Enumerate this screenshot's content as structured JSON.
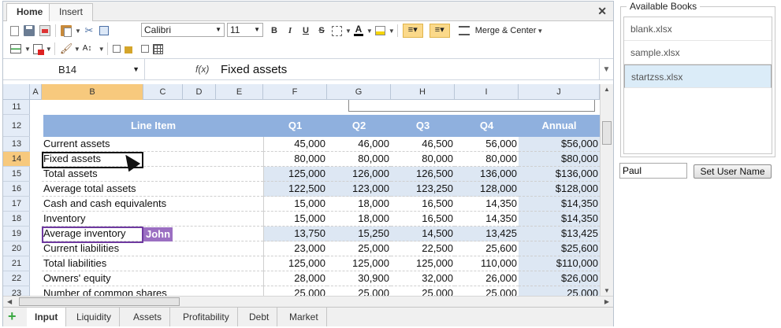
{
  "ribbon": {
    "tabs": [
      {
        "label": "Home",
        "active": true
      },
      {
        "label": "Insert",
        "active": false
      }
    ],
    "close_icon": "✕",
    "font_family": "Calibri",
    "font_size": "11",
    "bold": "B",
    "italic": "I",
    "underline": "U",
    "strike": "S",
    "font_color_glyph": "A",
    "merge_label": "Merge & Center"
  },
  "formula": {
    "cell_ref": "B14",
    "fx": "f(x)",
    "value": "Fixed assets"
  },
  "columns": [
    "A",
    "B",
    "C",
    "D",
    "E",
    "F",
    "G",
    "H",
    "I",
    "J"
  ],
  "active_column": "B",
  "rows": [
    "11",
    "12",
    "13",
    "14",
    "15",
    "16",
    "17",
    "18",
    "19",
    "20",
    "21",
    "22",
    "23"
  ],
  "active_row": "14",
  "table": {
    "headers": [
      "Line Item",
      "Q1",
      "Q2",
      "Q3",
      "Q4",
      "Annual"
    ],
    "data": [
      [
        "Current assets",
        "45,000",
        "46,000",
        "46,500",
        "56,000",
        "$56,000"
      ],
      [
        "Fixed assets",
        "80,000",
        "80,000",
        "80,000",
        "80,000",
        "$80,000"
      ],
      [
        "Total assets",
        "125,000",
        "126,000",
        "126,500",
        "136,000",
        "$136,000"
      ],
      [
        "Average total assets",
        "122,500",
        "123,000",
        "123,250",
        "128,000",
        "$128,000"
      ],
      [
        "Cash and cash equivalents",
        "15,000",
        "18,000",
        "16,500",
        "14,350",
        "$14,350"
      ],
      [
        "Inventory",
        "15,000",
        "18,000",
        "16,500",
        "14,350",
        "$14,350"
      ],
      [
        "Average inventory",
        "13,750",
        "15,250",
        "14,500",
        "13,425",
        "$13,425"
      ],
      [
        "Current liabilities",
        "23,000",
        "25,000",
        "22,500",
        "25,600",
        "$25,600"
      ],
      [
        "Total liabilities",
        "125,000",
        "125,000",
        "125,000",
        "110,000",
        "$110,000"
      ],
      [
        "Owners' equity",
        "28,000",
        "30,900",
        "32,000",
        "26,000",
        "$26,000"
      ],
      [
        "Number of common shares",
        "25,000",
        "25,000",
        "25,000",
        "25,000",
        "25,000"
      ]
    ],
    "shaded_rows": [
      2,
      3,
      6
    ]
  },
  "collaborator": {
    "name": "John",
    "color": "#9b6fc2",
    "row_index": 6
  },
  "sheet_tabs": [
    {
      "label": "Input",
      "active": true
    },
    {
      "label": "Liquidity",
      "active": false
    },
    {
      "label": "Assets",
      "active": false
    },
    {
      "label": "Profitability",
      "active": false
    },
    {
      "label": "Debt",
      "active": false
    },
    {
      "label": "Market",
      "active": false
    }
  ],
  "panel": {
    "legend": "Available Books",
    "books": [
      {
        "label": "blank.xlsx",
        "selected": false
      },
      {
        "label": "sample.xlsx",
        "selected": false
      },
      {
        "label": "startzss.xlsx",
        "selected": true
      }
    ],
    "user_name": "Paul",
    "set_user_label": "Set User Name"
  },
  "colors": {
    "header_fill": "#8fb0de",
    "shade_fill": "#dde7f3",
    "active_header": "#f7c97d",
    "selection": "#111111"
  }
}
